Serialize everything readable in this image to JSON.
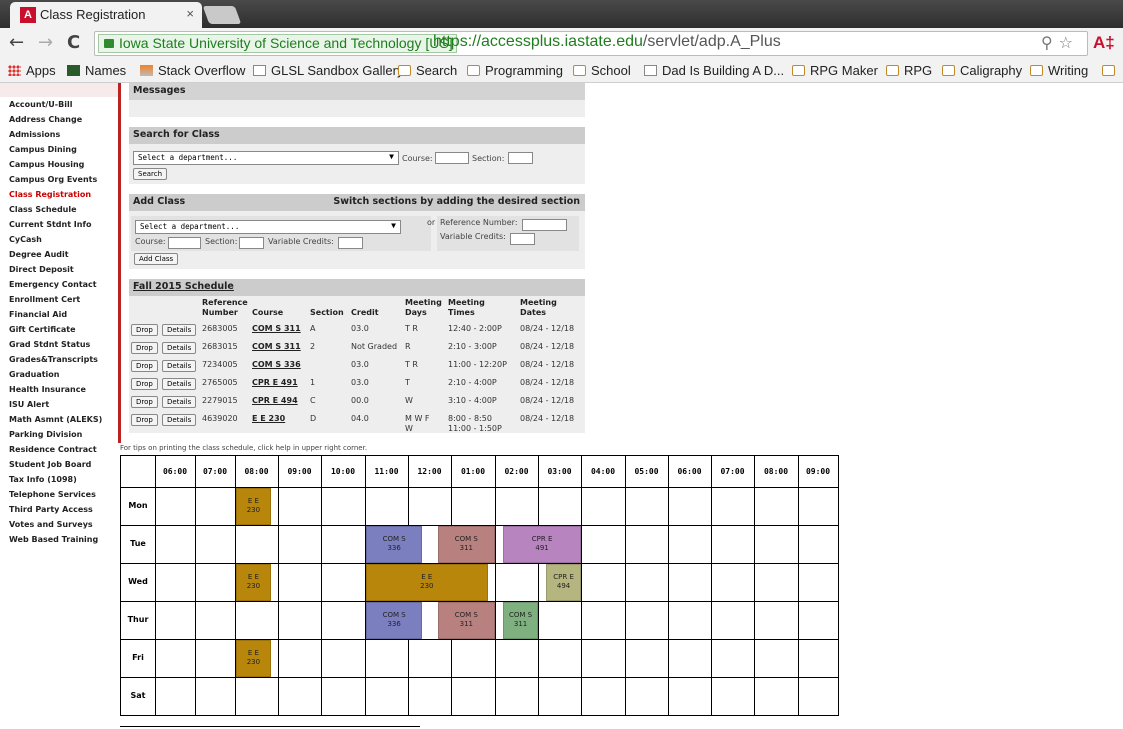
{
  "browser": {
    "tab_title": "Class Registration",
    "tab_close": "×",
    "ev_label": "Iowa State University of Science and Technology [US]",
    "url_scheme_host": "https://accessplus.iastate.edu",
    "url_path": "/servlet/adp.A_Plus",
    "back_glyph": "←",
    "forward_glyph": "→",
    "reload_glyph": "C",
    "omni_icons": "⚲☆",
    "ext_label": "A‡",
    "favicon_label": "A"
  },
  "bookmarks": [
    {
      "label": "Apps",
      "icon": "apps-grid-icon"
    },
    {
      "label": "Names",
      "icon": "names-icon"
    },
    {
      "label": "Stack Overflow",
      "icon": "stackoverflow-icon"
    },
    {
      "label": "GLSL Sandbox Gallery",
      "icon": "page-icon"
    },
    {
      "label": "Search",
      "icon": "folder-icon"
    },
    {
      "label": "Programming",
      "icon": "folder-icon"
    },
    {
      "label": "School",
      "icon": "folder-icon"
    },
    {
      "label": "Dad Is Building A D...",
      "icon": "page-icon"
    },
    {
      "label": "RPG Maker",
      "icon": "folder-icon"
    },
    {
      "label": "RPG",
      "icon": "folder-icon"
    },
    {
      "label": "Caligraphy",
      "icon": "folder-icon"
    },
    {
      "label": "Writing",
      "icon": "folder-icon"
    }
  ],
  "sidebar": {
    "items": [
      "Account/U-Bill",
      "Address Change",
      "Admissions",
      "Campus Dining",
      "Campus Housing",
      "Campus Org Events",
      "Class Registration",
      "Class Schedule",
      "Current Stdnt Info",
      "CyCash",
      "Degree Audit",
      "Direct Deposit",
      "Emergency Contact",
      "Enrollment Cert",
      "Financial Aid",
      "Gift Certificate",
      "Grad Stdnt Status",
      "Grades&Transcripts",
      "Graduation",
      "Health Insurance",
      "ISU Alert",
      "Math Asmnt (ALEKS)",
      "Parking Division",
      "Residence Contract",
      "Student Job Board",
      "Tax Info (1098)",
      "Telephone Services",
      "Third Party Access",
      "Votes and Surveys",
      "Web Based Training"
    ],
    "active": "Class Registration"
  },
  "messages": {
    "header": "Messages"
  },
  "search_class": {
    "header": "Search for Class",
    "dept_select": "Select a department...",
    "course_label": "Course:",
    "section_label": "Section:",
    "search_button": "Search"
  },
  "add_class": {
    "header": "Add Class",
    "header_right": "Switch sections by adding the desired section",
    "dept_select": "Select a department...",
    "course_label": "Course:",
    "section_label": "Section:",
    "variable_credits_label": "Variable Credits:",
    "or_label": "or",
    "reference_label": "Reference Number:",
    "variable_credits_label2": "Variable Credits:",
    "add_button": "Add Class"
  },
  "schedule": {
    "header": "Fall 2015 Schedule",
    "columns": {
      "ref1": "Reference",
      "ref2": "Number",
      "course": "Course",
      "section": "Section",
      "credit": "Credit",
      "days1": "Meeting",
      "days2": "Days",
      "times1": "Meeting",
      "times2": "Times",
      "dates1": "Meeting",
      "dates2": "Dates"
    },
    "drop_label": "Drop",
    "details_label": "Details",
    "rows": [
      {
        "ref": "2683005",
        "course": "COM S 311",
        "section": "A",
        "credit": "03.0",
        "days": "T R",
        "times": "12:40 - 2:00P",
        "dates": "08/24 - 12/18",
        "days2": "",
        "times2": ""
      },
      {
        "ref": "2683015",
        "course": "COM S 311",
        "section": "2",
        "credit": "Not Graded",
        "days": "R",
        "times": "2:10 - 3:00P",
        "dates": "08/24 - 12/18",
        "days2": "",
        "times2": ""
      },
      {
        "ref": "7234005",
        "course": "COM S 336",
        "section": "",
        "credit": "03.0",
        "days": "T R",
        "times": "11:00 - 12:20P",
        "dates": "08/24 - 12/18",
        "days2": "",
        "times2": ""
      },
      {
        "ref": "2765005",
        "course": "CPR E 491",
        "section": "1",
        "credit": "03.0",
        "days": "T",
        "times": "2:10 - 4:00P",
        "dates": "08/24 - 12/18",
        "days2": "",
        "times2": ""
      },
      {
        "ref": "2279015",
        "course": "CPR E 494",
        "section": "C",
        "credit": "00.0",
        "days": "W",
        "times": "3:10 - 4:00P",
        "dates": "08/24 - 12/18",
        "days2": "",
        "times2": ""
      },
      {
        "ref": "4639020",
        "course": "E E 230",
        "section": "D",
        "credit": "04.0",
        "days": "M W F",
        "times": "8:00 - 8:50",
        "dates": "08/24 - 12/18",
        "days2": "W",
        "times2": "11:00 - 1:50P"
      }
    ]
  },
  "tip_text": "For tips on printing the class schedule, click help in upper right corner.",
  "calendar": {
    "hours": [
      "06:00",
      "07:00",
      "08:00",
      "09:00",
      "10:00",
      "11:00",
      "12:00",
      "01:00",
      "02:00",
      "03:00",
      "04:00",
      "05:00",
      "06:00",
      "07:00",
      "08:00",
      "09:00"
    ],
    "days": [
      "Mon",
      "Tue",
      "Wed",
      "Thur",
      "Fri",
      "Sat"
    ],
    "blocks": [
      {
        "day": 0,
        "start": 8.0,
        "end": 8.833,
        "line1": "E E",
        "line2": "230",
        "color": "#b8860b"
      },
      {
        "day": 1,
        "start": 11.0,
        "end": 12.333,
        "line1": "COM S",
        "line2": "336",
        "color": "#7b7fbf"
      },
      {
        "day": 1,
        "start": 12.667,
        "end": 14.0,
        "line1": "COM S",
        "line2": "311",
        "color": "#b98080"
      },
      {
        "day": 1,
        "start": 14.167,
        "end": 16.0,
        "line1": "CPR E",
        "line2": "491",
        "color": "#b884c0"
      },
      {
        "day": 2,
        "start": 8.0,
        "end": 8.833,
        "line1": "E E",
        "line2": "230",
        "color": "#b8860b"
      },
      {
        "day": 2,
        "start": 11.0,
        "end": 13.833,
        "line1": "E E",
        "line2": "230",
        "color": "#b8860b"
      },
      {
        "day": 2,
        "start": 15.167,
        "end": 16.0,
        "line1": "CPR E",
        "line2": "494",
        "color": "#b5b580"
      },
      {
        "day": 3,
        "start": 11.0,
        "end": 12.333,
        "line1": "COM S",
        "line2": "336",
        "color": "#7b7fbf"
      },
      {
        "day": 3,
        "start": 12.667,
        "end": 14.0,
        "line1": "COM S",
        "line2": "311",
        "color": "#b98080"
      },
      {
        "day": 3,
        "start": 14.167,
        "end": 15.0,
        "line1": "COM S",
        "line2": "311",
        "color": "#7fb07f"
      },
      {
        "day": 4,
        "start": 8.0,
        "end": 8.833,
        "line1": "E E",
        "line2": "230",
        "color": "#b8860b"
      }
    ]
  }
}
